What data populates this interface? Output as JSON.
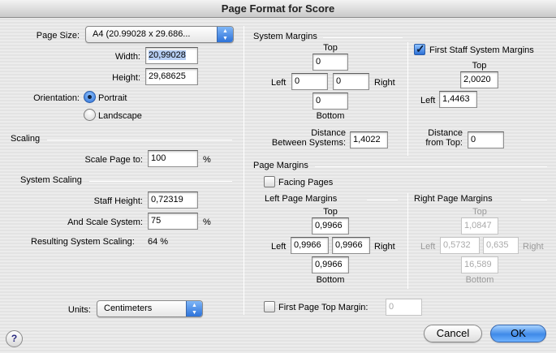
{
  "window": {
    "title": "Page Format for Score"
  },
  "page": {
    "size_label": "Page Size:",
    "size_value": "A4 (20.99028 x 29.686...",
    "width_label": "Width:",
    "width_value": "20,99028",
    "height_label": "Height:",
    "height_value": "29,68625",
    "orientation_label": "Orientation:",
    "portrait_label": "Portrait",
    "landscape_label": "Landscape"
  },
  "scaling": {
    "title": "Scaling",
    "scale_label": "Scale Page to:",
    "scale_value": "100",
    "percent": "%"
  },
  "system_scaling": {
    "title": "System Scaling",
    "staff_height_label": "Staff Height:",
    "staff_height_value": "0,72319",
    "and_scale_label": "And Scale System:",
    "and_scale_value": "75",
    "percent": "%",
    "result_label": "Resulting System Scaling:",
    "result_value": "64 %"
  },
  "units": {
    "label": "Units:",
    "value": "Centimeters"
  },
  "system_margins": {
    "title": "System Margins",
    "top_label": "Top",
    "top_value": "0",
    "left_label": "Left",
    "left_value": "0",
    "right_label": "Right",
    "right_value": "0",
    "bottom_label": "Bottom",
    "bottom_value": "0",
    "distance_label_1": "Distance",
    "distance_label_2": "Between Systems:",
    "distance_value": "1,4022"
  },
  "first_staff": {
    "label": "First Staff System Margins",
    "top_label": "Top",
    "top_value": "2,0020",
    "left_label": "Left",
    "left_value": "1,4463",
    "distance_label_1": "Distance",
    "distance_label_2": "from Top:",
    "distance_value": "0"
  },
  "page_margins": {
    "title": "Page Margins",
    "facing_label": "Facing Pages",
    "left_page": {
      "title": "Left Page Margins",
      "top_label": "Top",
      "top_value": "0,9966",
      "left_label": "Left",
      "left_value": "0,9966",
      "right_label": "Right",
      "right_value": "0,9966",
      "bottom_label": "Bottom",
      "bottom_value": "0,9966"
    },
    "right_page": {
      "title": "Right Page Margins",
      "top_label": "Top",
      "top_value": "1,0847",
      "left_label": "Left",
      "left_value": "0,5732",
      "right_label": "Right",
      "right_value": "0,635",
      "bottom_label": "Bottom",
      "bottom_value": "16,589"
    },
    "first_page_label": "First Page Top Margin:",
    "first_page_value": "0"
  },
  "buttons": {
    "cancel": "Cancel",
    "ok": "OK",
    "help": "?"
  },
  "colors": {
    "accent": "#3f8ae8",
    "selection": "#b5cdf2"
  }
}
